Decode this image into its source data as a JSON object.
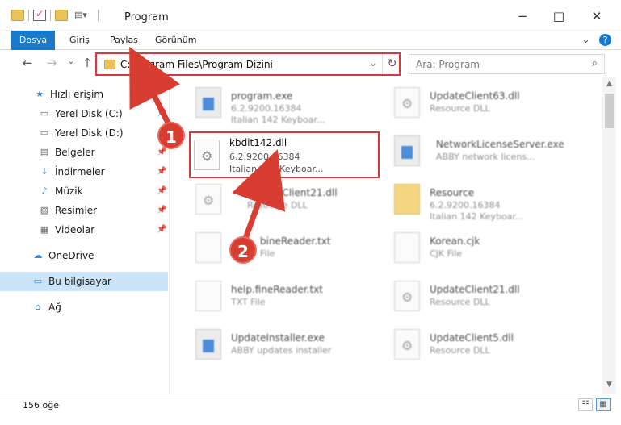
{
  "window": {
    "title": "Program",
    "controls": {
      "minimize": "−",
      "maximize": "□",
      "close": "✕"
    }
  },
  "ribbon": {
    "tabs": [
      "Dosya",
      "Giriş",
      "Paylaş",
      "Görünüm"
    ],
    "expand_icon": "⌄",
    "help_icon": "?"
  },
  "nav": {
    "back_icon": "←",
    "forward_icon": "→",
    "recent_icon": "⌄",
    "up_icon": "↑",
    "path": "C:\\Program Files\\Program Dizini",
    "dropdown_icon": "⌄",
    "refresh_icon": "↻",
    "search_placeholder": "Ara: Program",
    "search_icon": "⌕"
  },
  "sidebar": {
    "items": [
      {
        "label": "Hızlı erişim",
        "icon": "★"
      },
      {
        "label": "Yerel Disk (C:)",
        "icon": "▭"
      },
      {
        "label": "Yerel Disk (D:)",
        "icon": "▭"
      },
      {
        "label": "Belgeler",
        "icon": "▤"
      },
      {
        "label": "İndirmeler",
        "icon": "↓"
      },
      {
        "label": "Müzik",
        "icon": "♪"
      },
      {
        "label": "Resimler",
        "icon": "▧"
      },
      {
        "label": "Videolar",
        "icon": "▦"
      },
      {
        "label": "OneDrive",
        "icon": "☁"
      },
      {
        "label": "Bu bilgisayar",
        "icon": "▭"
      },
      {
        "label": "Ağ",
        "icon": "⌂"
      }
    ],
    "pin_icon": "📌"
  },
  "files": [
    {
      "name": "program.exe",
      "line1": "6.2.9200.16384",
      "line2": "Italian 142 Keyboar..."
    },
    {
      "name": "UpdateClient63.dll",
      "line1": "Resource DLL",
      "line2": ""
    },
    {
      "name": "kbdit142.dll",
      "line1": "6.2.9200.16384",
      "line2": "Italian 142 Keyboar..."
    },
    {
      "name": "NetworkLicenseServer.exe",
      "line1": "ABBY network licens...",
      "line2": ""
    },
    {
      "name": "UpdateClient21.dll",
      "line1": "Resource DLL",
      "line2": ""
    },
    {
      "name": "Resource",
      "line1": "6.2.9200.16384",
      "line2": "Italian 142 Keyboar..."
    },
    {
      "name": "bineReader.txt",
      "line1": "File",
      "line2": ""
    },
    {
      "name": "Korean.cjk",
      "line1": "CJK File",
      "line2": ""
    },
    {
      "name": "help.fineReader.txt",
      "line1": "TXT File",
      "line2": ""
    },
    {
      "name": "UpdateClient21.dll",
      "line1": "Resource DLL",
      "line2": ""
    },
    {
      "name": "UpdateInstaller.exe",
      "line1": "ABBY updates installer",
      "line2": ""
    },
    {
      "name": "UpdateClient5.dll",
      "line1": "Resource DLL",
      "line2": ""
    }
  ],
  "status": {
    "count": "156 öğe",
    "details_icon": "☷",
    "large_icon": "▦"
  },
  "annotations": {
    "step1": "1",
    "step2": "2",
    "colors": {
      "highlight": "#d63b3b",
      "badge": "#d83d32"
    }
  }
}
